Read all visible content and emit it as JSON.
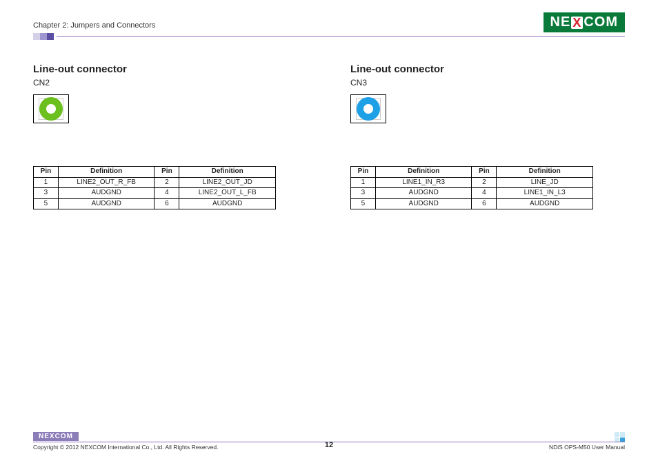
{
  "header": {
    "chapter": "Chapter 2: Jumpers and Connectors",
    "brand_pre": "NE",
    "brand_x": "X",
    "brand_post": "COM"
  },
  "left": {
    "title": "Line-out connector",
    "id": "CN2",
    "jack_color": "green",
    "th_pin": "Pin",
    "th_def": "Definition",
    "rows": [
      {
        "p1": "1",
        "d1": "LINE2_OUT_R_FB",
        "p2": "2",
        "d2": "LINE2_OUT_JD"
      },
      {
        "p1": "3",
        "d1": "AUDGND",
        "p2": "4",
        "d2": "LINE2_OUT_L_FB"
      },
      {
        "p1": "5",
        "d1": "AUDGND",
        "p2": "6",
        "d2": "AUDGND"
      }
    ]
  },
  "right": {
    "title": "Line-out connector",
    "id": "CN3",
    "jack_color": "blue",
    "th_pin": "Pin",
    "th_def": "Definition",
    "rows": [
      {
        "p1": "1",
        "d1": "LINE1_IN_R3",
        "p2": "2",
        "d2": "LINE_JD"
      },
      {
        "p1": "3",
        "d1": "AUDGND",
        "p2": "4",
        "d2": "LINE1_IN_L3"
      },
      {
        "p1": "5",
        "d1": "AUDGND",
        "p2": "6",
        "d2": "AUDGND"
      }
    ]
  },
  "footer": {
    "copyright": "Copyright © 2012 NEXCOM International Co., Ltd. All Rights Reserved.",
    "page": "12",
    "doc": "NDiS OPS-M50 User Manual",
    "brand_pre": "NE",
    "brand_x": "X",
    "brand_post": "COM"
  }
}
